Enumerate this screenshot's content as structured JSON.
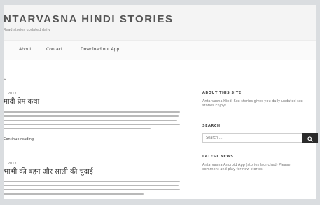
{
  "header": {
    "title": "NTARVASNA HINDI STORIES",
    "tagline": "Read stories updated daily"
  },
  "nav": {
    "items": [
      {
        "label": "About"
      },
      {
        "label": "Contact"
      },
      {
        "label": "Download our App"
      }
    ]
  },
  "main": {
    "heading_fragment": "s",
    "posts": [
      {
        "date": "L, 2017",
        "title": "मादी प्रेम कथा",
        "more": "Continue reading"
      },
      {
        "date": "L, 2017",
        "title": "भाभी की बहन और साली की चुदाई",
        "more": ""
      }
    ]
  },
  "sidebar": {
    "about": {
      "title": "ABOUT THIS SITE",
      "text": "Antarvasna Hindi Sex stories gives you daily updated sex stories Enjoy!"
    },
    "search": {
      "title": "SEARCH",
      "placeholder": "Search ...",
      "button_icon": "search-icon"
    },
    "latest": {
      "title": "LATEST NEWS",
      "text": "Antarvasna Android App (stories launched) Please comment and play for new stories"
    }
  }
}
